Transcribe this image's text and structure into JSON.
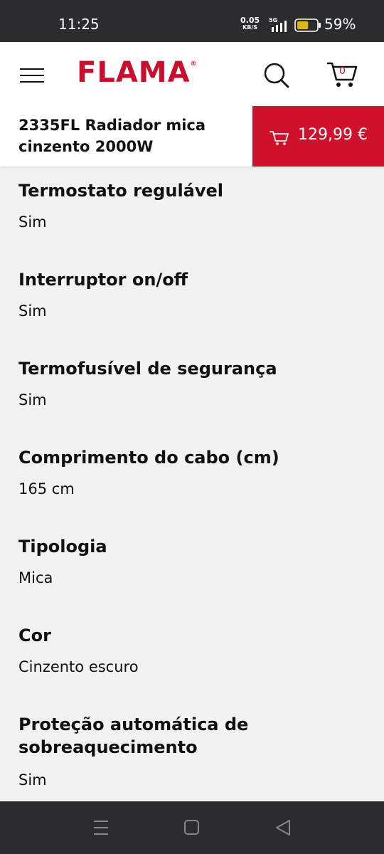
{
  "status": {
    "time": "11:25",
    "net_speed": "0.05",
    "net_unit": "KB/S",
    "signal": "5G",
    "battery_pct": "59%",
    "battery_level": 0.59
  },
  "header": {
    "logo": "FLAMA",
    "logo_mark": "®",
    "cart_count": "0",
    "brand_color": "#c8102e"
  },
  "product": {
    "title": "2335FL Radiador mica cinzento 2000W",
    "price": "129,99 €"
  },
  "specs": [
    {
      "label": "Termostato regulável",
      "value": "Sim"
    },
    {
      "label": "Interruptor on/off",
      "value": "Sim"
    },
    {
      "label": "Termofusível de segurança",
      "value": "Sim"
    },
    {
      "label": "Comprimento do cabo (cm)",
      "value": "165 cm"
    },
    {
      "label": "Tipologia",
      "value": "Mica"
    },
    {
      "label": "Cor",
      "value": "Cinzento escuro"
    },
    {
      "label": "Proteção automática de sobreaquecimento",
      "value": "Sim"
    }
  ],
  "icons": [
    "menu-icon",
    "search-icon",
    "cart-icon",
    "recents-icon",
    "home-icon",
    "back-icon"
  ]
}
